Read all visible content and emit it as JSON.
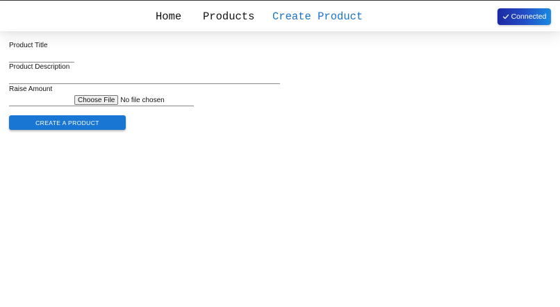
{
  "nav": {
    "home": "Home",
    "products": "Products",
    "create_product": "Create Product"
  },
  "wallet": {
    "status_label": "Connected",
    "icon": "check-icon"
  },
  "colors": {
    "active_nav": "#1a73c8",
    "primary_button": "#1976d2",
    "connected_gradient_start": "#1b2aa0",
    "connected_gradient_end": "#1a8ae0"
  },
  "form": {
    "title_label": "Product Title",
    "title_value": "",
    "description_label": "Product Description",
    "description_value": "",
    "raise_label": "Raise Amount",
    "raise_value": "",
    "file_button_label": "Choose File",
    "file_status": "No file chosen",
    "submit_label": "CREATE A PRODUCT"
  }
}
